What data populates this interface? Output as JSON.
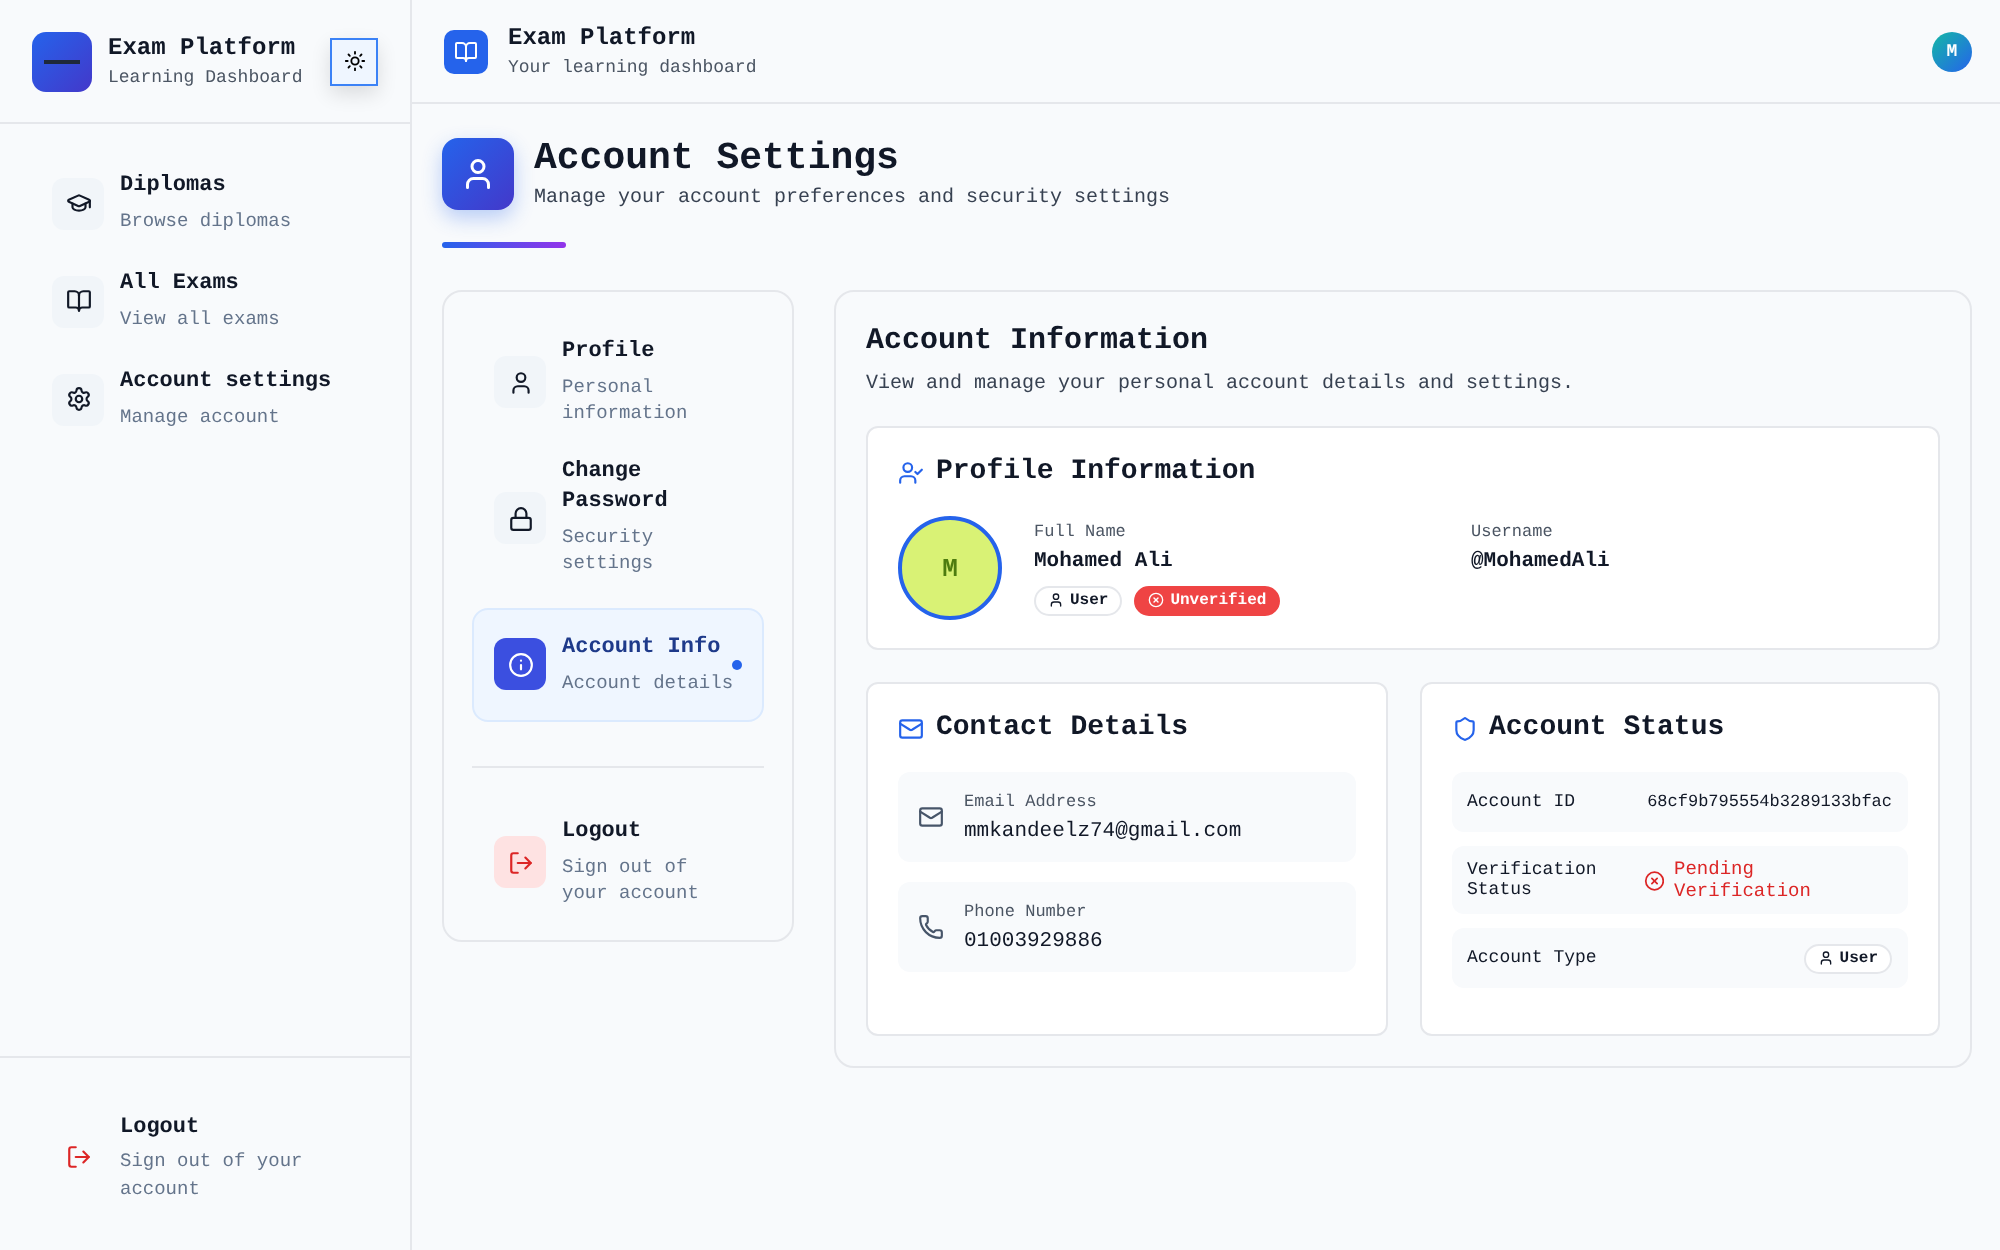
{
  "sidebar": {
    "title": "Exam Platform",
    "subtitle": "Learning Dashboard",
    "items": [
      {
        "label": "Diplomas",
        "sub": "Browse diplomas",
        "selected": false
      },
      {
        "label": "All Exams",
        "sub": "View all exams",
        "selected": false
      },
      {
        "label": "Account settings",
        "sub": "Manage account",
        "selected": false
      }
    ],
    "logout": {
      "label": "Logout",
      "sub": "Sign out of your account"
    }
  },
  "topbar": {
    "title": "Exam Platform",
    "subtitle": "Your learning dashboard",
    "avatar": "M"
  },
  "page": {
    "title": "Account Settings",
    "subtitle": "Manage your account preferences and security settings"
  },
  "settings_menu": {
    "items": [
      {
        "label": "Profile",
        "sub": "Personal information",
        "selected": false
      },
      {
        "label": "Change Password",
        "sub": "Security settings",
        "selected": false
      },
      {
        "label": "Account Info",
        "sub": "Account details",
        "selected": true
      }
    ],
    "logout": {
      "label": "Logout",
      "sub": "Sign out of your account"
    }
  },
  "account": {
    "title": "Account Information",
    "subtitle": "View and manage your personal account details and settings.",
    "profile": {
      "title": "Profile Information",
      "avatar": "M",
      "fields": [
        {
          "label": "Full Name",
          "value": "Mohamed Ali"
        },
        {
          "label": "Username",
          "value": "@MohamedAli"
        }
      ],
      "role": "User",
      "verified": false,
      "status_badge": "Unverified"
    },
    "contact": {
      "title": "Contact Details",
      "fields": [
        {
          "label": "Email Address",
          "value": "mmkandeelz74@gmail.com"
        },
        {
          "label": "Phone Number",
          "value": "01003929886"
        }
      ]
    },
    "status": {
      "title": "Account Status",
      "rows": [
        {
          "kind": "text",
          "label": "Account ID",
          "value": "68cf9b795554b3289133bfac"
        },
        {
          "kind": "error",
          "label": "Verification Status",
          "value": "Pending Verification"
        },
        {
          "kind": "badge",
          "label": "Account Type",
          "value": "User"
        }
      ]
    }
  }
}
